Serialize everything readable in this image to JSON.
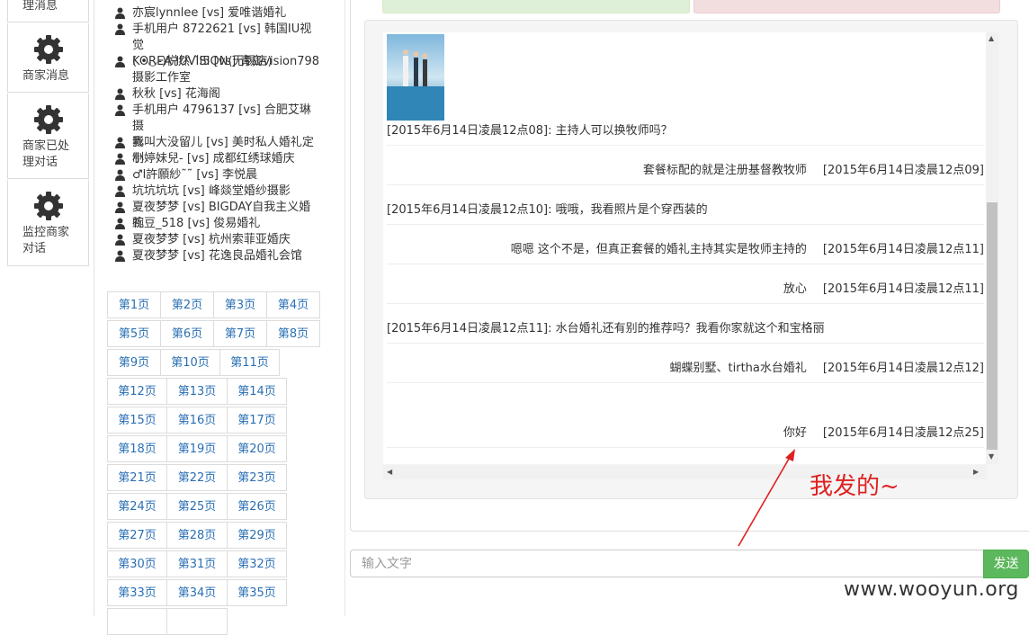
{
  "nav": {
    "items": [
      {
        "label_line1": "理消息",
        "label_line2": ""
      },
      {
        "label_line1": "商家消息",
        "label_line2": ""
      },
      {
        "label_line1": "商家已处",
        "label_line2": "理对话"
      },
      {
        "label_line1": "监控商家",
        "label_line2": "对话"
      }
    ]
  },
  "users": [
    {
      "line1": "亦宸lynnlee [vs] 爱唯谐婚礼",
      "line2": ""
    },
    {
      "line1": "手机用户 8722621 [vs] 韩国IU视觉",
      "line2": "KOREA IUVISION(无锡店)"
    },
    {
      "line1": "( •◡-)悦然 ˇl5 [vs] 青岛vision798",
      "line2": "摄影工作室"
    },
    {
      "line1": "秋秋 [vs] 花海阁",
      "line2": ""
    },
    {
      "line1": "手机用户 4796137 [vs] 合肥艾琳摄",
      "line2": "影"
    },
    {
      "line1": "我叫大没留儿 [vs] 美时私人婚礼定制",
      "line2": ""
    },
    {
      "line1": "小婷妹兒- [vs] 成都红绣球婚庆",
      "line2": ""
    },
    {
      "line1": "♂l許願紗˜˜ [vs] 李悦晨",
      "line2": ""
    },
    {
      "line1": "坑坑坑坑 [vs] 峰燚堂婚纱摄影",
      "line2": ""
    },
    {
      "line1": "夏夜梦梦 [vs] BIGDAY自我主义婚礼",
      "line2": ""
    },
    {
      "line1": "豌豆_518 [vs] 俊易婚礼",
      "line2": ""
    },
    {
      "line1": "夏夜梦梦 [vs] 杭州索菲亚婚庆",
      "line2": ""
    },
    {
      "line1": "夏夜梦梦 [vs] 花逸良品婚礼会馆",
      "line2": ""
    }
  ],
  "pages": [
    "第1页",
    "第2页",
    "第3页",
    "第4页",
    "第5页",
    "第6页",
    "第7页",
    "第8页",
    "第9页",
    "第10页",
    "第11页",
    "第12页",
    "第13页",
    "第14页",
    "第15页",
    "第16页",
    "第17页",
    "第18页",
    "第19页",
    "第20页",
    "第21页",
    "第22页",
    "第23页",
    "第24页",
    "第25页",
    "第26页",
    "第27页",
    "第28页",
    "第29页",
    "第30页",
    "第31页",
    "第32页",
    "第33页",
    "第34页",
    "第35页"
  ],
  "messages": [
    {
      "dir": "recv",
      "text": "[2015年6月14日凌晨12点08]: 主持人可以换牧师吗？"
    },
    {
      "dir": "sent",
      "text": "套餐标配的就是注册基督教牧师",
      "time": "[2015年6月14日凌晨12点09]"
    },
    {
      "dir": "recv",
      "text": "[2015年6月14日凌晨12点10]: 哦哦，我看照片是个穿西装的"
    },
    {
      "dir": "sent",
      "text": "嗯嗯 这个不是，但真正套餐的婚礼主持其实是牧师主持的",
      "time": "[2015年6月14日凌晨12点11]"
    },
    {
      "dir": "sent",
      "text": "放心",
      "time": "[2015年6月14日凌晨12点11]"
    },
    {
      "dir": "recv",
      "text": "[2015年6月14日凌晨12点11]: 水台婚礼还有别的推荐吗？我看你家就这个和宝格丽"
    },
    {
      "dir": "sent",
      "text": "蝴蝶别墅、tirtha水台婚礼",
      "time": "[2015年6月14日凌晨12点12]"
    },
    {
      "dir": "sent",
      "text": "你好",
      "time": "[2015年6月14日凌晨12点25]"
    }
  ],
  "composer": {
    "placeholder": "输入文字",
    "send_label": "发送"
  },
  "annotation": "我发的~",
  "watermark": "www.wooyun.org",
  "colors": {
    "send": "#5cb85c",
    "annotation": "#e02020",
    "link": "#2a6fb4"
  }
}
